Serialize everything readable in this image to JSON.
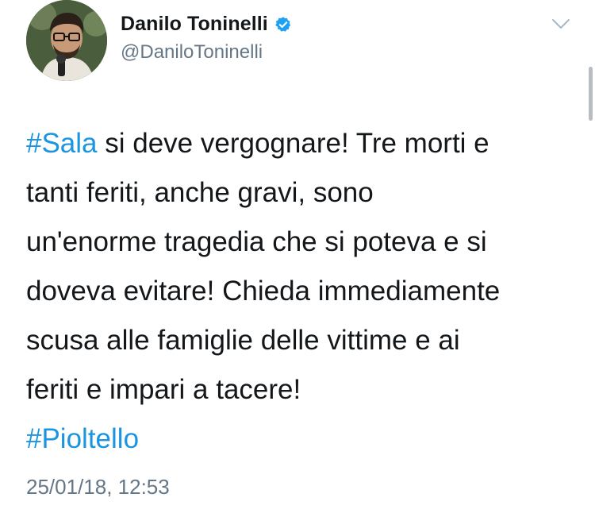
{
  "author": {
    "display_name": "Danilo Toninelli",
    "handle": "@DaniloToninelli",
    "verified": true
  },
  "tweet": {
    "lines": [
      {
        "hashtag": "#Sala",
        "text": " si deve vergognare! Tre morti e"
      },
      {
        "text": "tanti feriti, anche gravi, sono"
      },
      {
        "text": "un'enorme tragedia che si poteva e si"
      },
      {
        "text": "doveva evitare! Chieda immediamente"
      },
      {
        "text": "scusa alle famiglie delle vittime e ai"
      },
      {
        "text": "feriti e impari a tacere!"
      },
      {
        "hashtag": "#Pioltello"
      }
    ],
    "timestamp": "25/01/18, 12:53"
  },
  "icons": {
    "verified": "verified-badge-icon",
    "menu": "chevron-down-icon"
  },
  "colors": {
    "hashtag": "#1b95e0",
    "verified": "#1da1f2",
    "secondary_text": "#657786"
  }
}
